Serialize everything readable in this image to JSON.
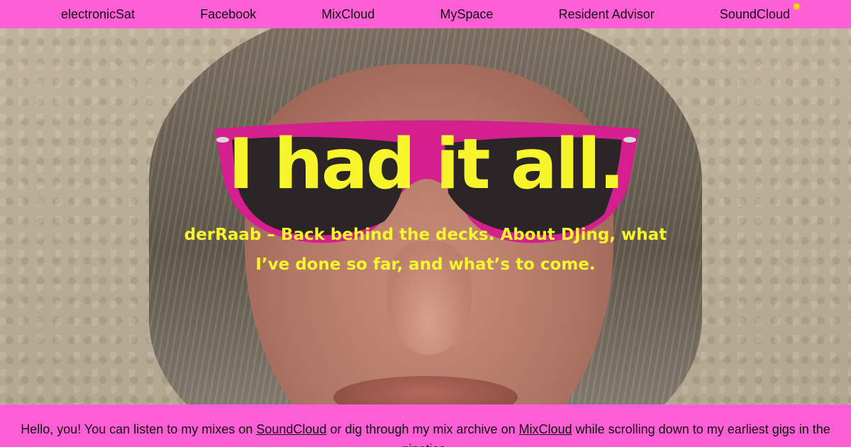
{
  "nav": {
    "items": [
      {
        "label": "electronicSat"
      },
      {
        "label": "Facebook"
      },
      {
        "label": "MixCloud"
      },
      {
        "label": "MySpace"
      },
      {
        "label": "Resident Advisor"
      },
      {
        "label": "SoundCloud"
      }
    ],
    "sparkle_icon": "sparkle-icon"
  },
  "hero": {
    "headline": "I had it all.",
    "subline": "derRaab – Back behind the decks. About DJing, what I’ve done so far, and what’s to come."
  },
  "intro": {
    "part1": "Hello, you! You can listen to my mixes on ",
    "link1": "SoundCloud",
    "part2": " or dig through my mix archive on ",
    "link2": "MixCloud",
    "part3": " while scrolling down to my earliest gigs in the nineties."
  },
  "colors": {
    "accent_pink": "#ff5fd6",
    "headline_yellow": "#f7f52b",
    "glasses_magenta": "#d61f8e"
  }
}
